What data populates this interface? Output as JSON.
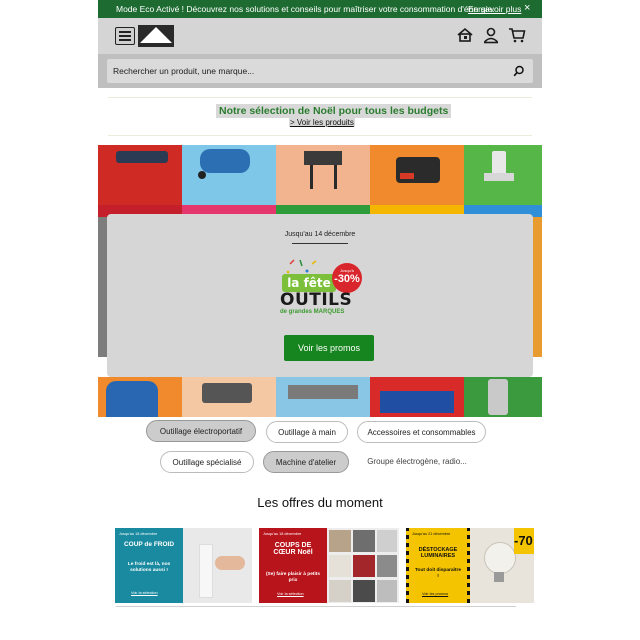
{
  "eco_bar": {
    "message": "Mode Eco Activé ! Découvrez nos solutions et conseils pour maîtriser votre consommation d'énergie.",
    "link": "En savoir plus",
    "close": "×"
  },
  "header": {
    "logo_text": "LEROY MERLIN",
    "icons": [
      "menu-icon",
      "home-icon",
      "account-icon",
      "cart-icon"
    ]
  },
  "search": {
    "placeholder": "Rechercher un produit, une marque..."
  },
  "promo": {
    "title": "Notre sélection de Noël pour tous les budgets",
    "link": "> Voir les produits"
  },
  "banner": {
    "date": "Jusqu'au 14 décembre",
    "fete_line1": "la fête",
    "fete_discount": "-30%",
    "fete_discount_prefix": "Jusqu'à",
    "fete_line2": "OUTILS",
    "fete_line3": "de grandes MARQUES",
    "cta": "Voir les promos"
  },
  "categories": [
    {
      "label": "Outillage électroportatif"
    },
    {
      "label": "Outillage à main"
    },
    {
      "label": "Accessoires et consommables"
    },
    {
      "label": "Outillage spécialisé"
    },
    {
      "label": "Machine d'atelier"
    },
    {
      "label": "Groupe électrogène, radio..."
    }
  ],
  "offers_title": "Les offres du moment",
  "offers": [
    {
      "date": "Jusqu'au 18 décembre",
      "title": "COUP de FROID",
      "subtitle": "Le froid est là, nos solutions aussi !",
      "link": "Voir la sélection"
    },
    {
      "date": "Jusqu'au 18 décembre",
      "title": "COUPS DE CŒUR Noël",
      "subtitle": "(Se) faire plaisir à petits prix",
      "link": "Voir la sélection"
    },
    {
      "date": "Jusqu'au 21 décembre",
      "title": "DÉSTOCKAGE LUMINAIRES",
      "subtitle": "Tout doit disparaître !",
      "link": "Voir les promos",
      "badge": "-70"
    }
  ],
  "colors": {
    "brand_green": "#17851f",
    "eco_bar": "#1e6b32",
    "promo_title": "#2a7d2e"
  }
}
